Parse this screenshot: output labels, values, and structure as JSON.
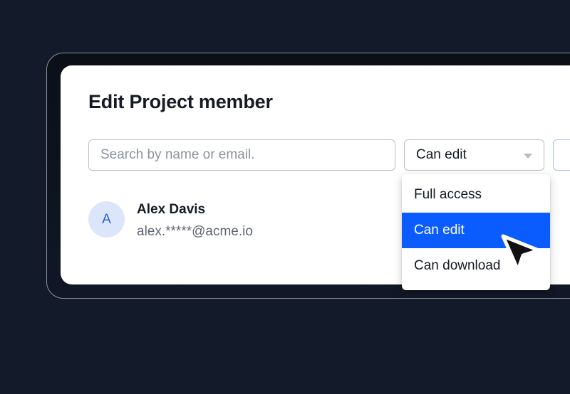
{
  "dialog": {
    "title": "Edit Project member"
  },
  "search": {
    "placeholder": "Search by name or email."
  },
  "permission_select": {
    "selected": "Can edit",
    "options": [
      "Full access",
      "Can edit",
      "Can download"
    ],
    "selected_index": 1
  },
  "member": {
    "avatar_initial": "A",
    "name": "Alex Davis",
    "email": "alex.*****@acme.io"
  },
  "colors": {
    "background": "#131a2a",
    "accent": "#0b5cff",
    "avatar_bg": "#dce6fb",
    "avatar_fg": "#2d5bd6"
  },
  "icons": {
    "select_caret": "caret-down-icon",
    "pointer": "cursor-arrow-icon"
  }
}
